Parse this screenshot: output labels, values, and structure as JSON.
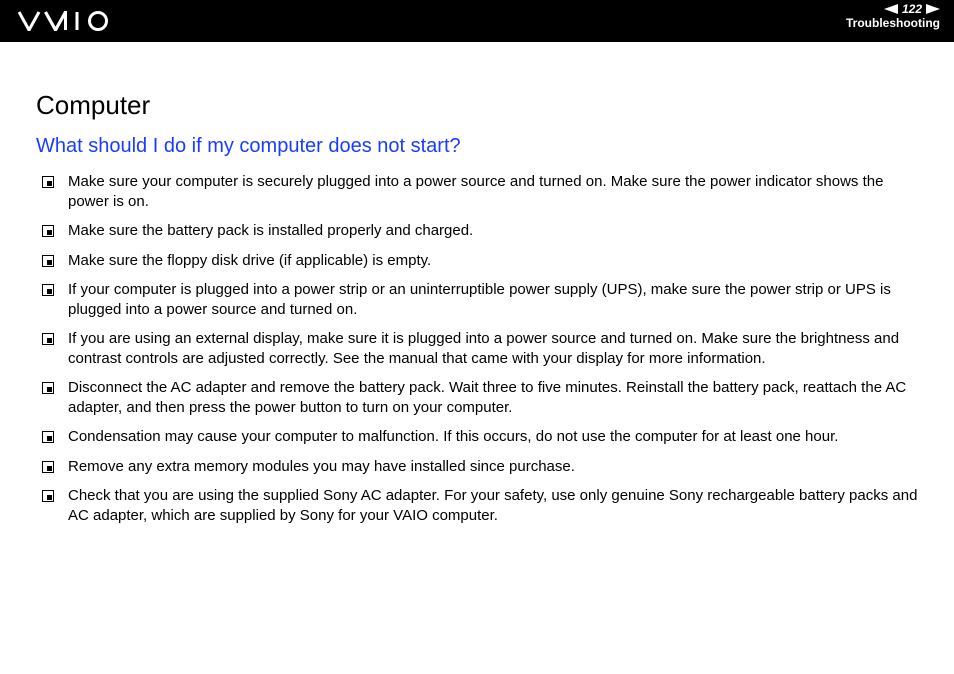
{
  "header": {
    "page_number": "122",
    "section": "Troubleshooting"
  },
  "content": {
    "title": "Computer",
    "question": "What should I do if my computer does not start?",
    "items": [
      "Make sure your computer is securely plugged into a power source and turned on. Make sure the power indicator shows the power is on.",
      "Make sure the battery pack is installed properly and charged.",
      "Make sure the floppy disk drive (if applicable) is empty.",
      "If your computer is plugged into a power strip or an uninterruptible power supply (UPS), make sure the power strip or UPS is plugged into a power source and turned on.",
      "If you are using an external display, make sure it is plugged into a power source and turned on. Make sure the brightness and contrast controls are adjusted correctly. See the manual that came with your display for more information.",
      "Disconnect the AC adapter and remove the battery pack. Wait three to five minutes. Reinstall the battery pack, reattach the AC adapter, and then press the power button to turn on your computer.",
      "Condensation may cause your computer to malfunction. If this occurs, do not use the computer for at least one hour.",
      "Remove any extra memory modules you may have installed since purchase.",
      "Check that you are using the supplied Sony AC adapter. For your safety, use only genuine Sony rechargeable battery packs and AC adapter, which are supplied by Sony for your VAIO computer."
    ]
  }
}
